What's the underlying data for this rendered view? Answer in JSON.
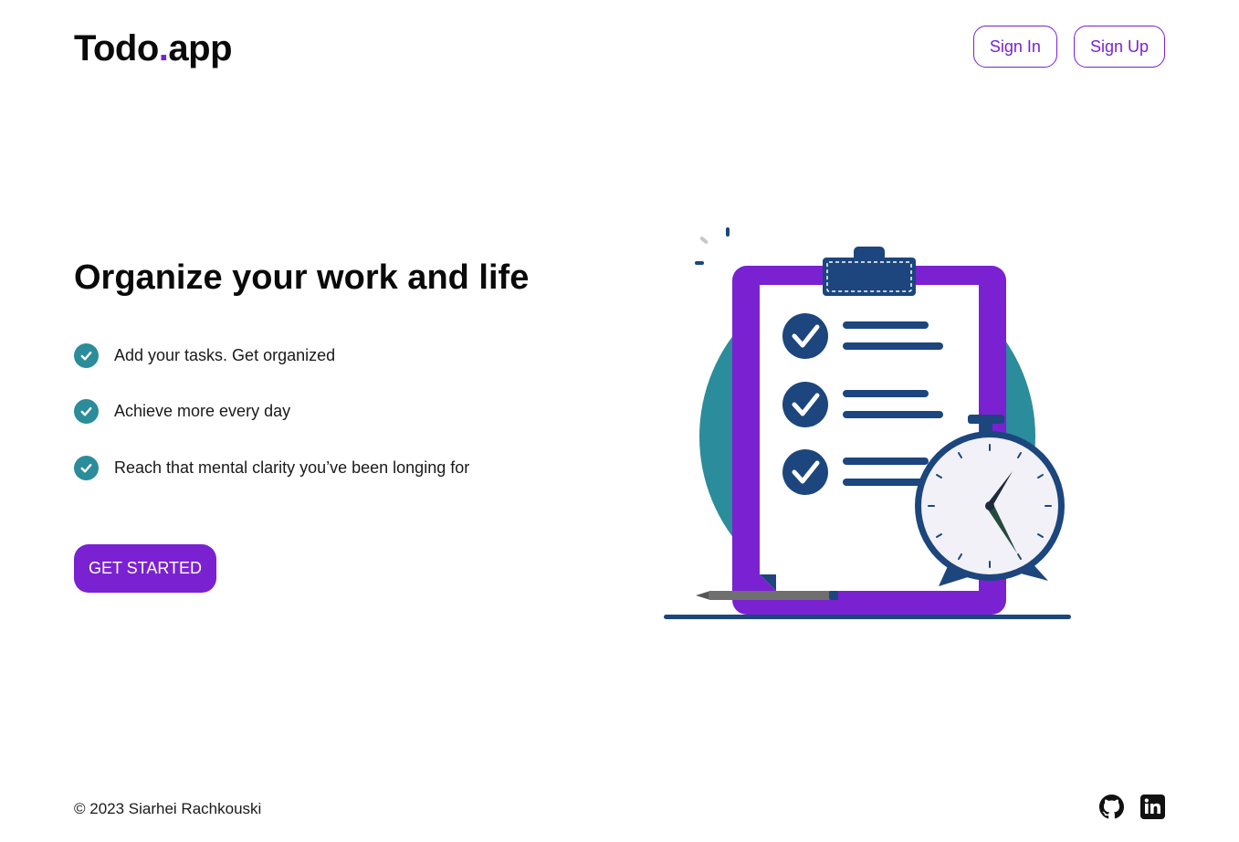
{
  "header": {
    "logo_main": "Todo",
    "logo_dot": ".",
    "logo_suffix": "app",
    "sign_in_label": "Sign In",
    "sign_up_label": "Sign Up"
  },
  "hero": {
    "title": "Organize your work and life",
    "features": [
      {
        "text": "Add your tasks. Get organized",
        "icon": "check-circle-icon"
      },
      {
        "text": "Achieve more every day",
        "icon": "check-circle-icon"
      },
      {
        "text": "Reach that mental clarity you’ve been longing for",
        "icon": "check-circle-icon"
      }
    ],
    "cta_label": "GET STARTED"
  },
  "illustration": {
    "icon": "clipboard-stopwatch-illustration"
  },
  "footer": {
    "copyright": "© 2023 Siarhei Rachkouski",
    "socials": [
      {
        "icon": "github-icon"
      },
      {
        "icon": "linkedin-icon"
      }
    ]
  },
  "colors": {
    "accent": "#7a21d1",
    "teal": "#2b8c9b",
    "navy": "#1c467d"
  }
}
